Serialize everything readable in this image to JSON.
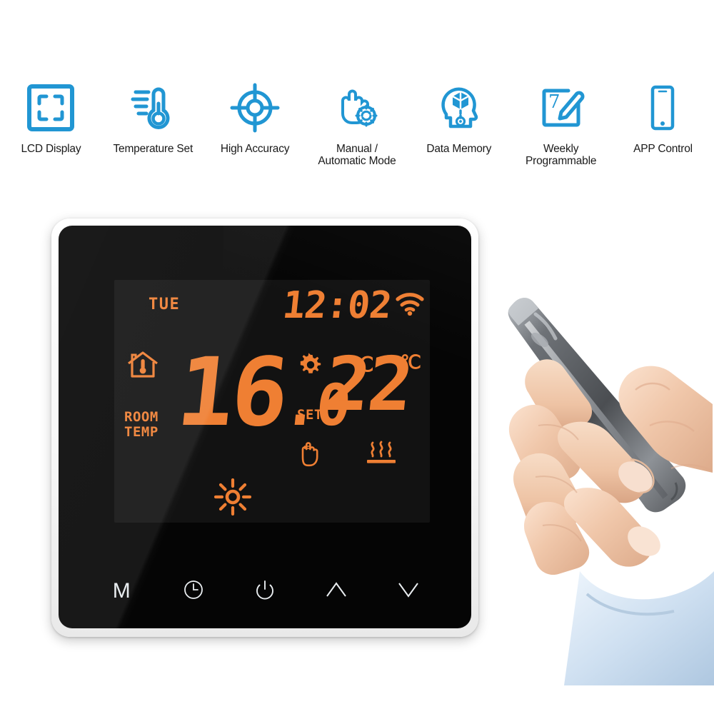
{
  "features": [
    {
      "icon": "lcd-display-icon",
      "label": "LCD Display"
    },
    {
      "icon": "thermometer-icon",
      "label": "Temperature Set"
    },
    {
      "icon": "crosshair-target-icon",
      "label": "High Accuracy"
    },
    {
      "icon": "hand-touch-auto-icon",
      "label": "Manual /\nAutomatic Mode"
    },
    {
      "icon": "head-memory-icon",
      "label": "Data Memory"
    },
    {
      "icon": "calendar-pencil-icon",
      "label": "Weekly\nProgrammable"
    },
    {
      "icon": "smartphone-icon",
      "label": "APP Control"
    }
  ],
  "thermostat": {
    "lcd": {
      "weekday": "TUE",
      "clock": "12:02",
      "wifi_icon": "wifi-icon",
      "room_icon": "house-thermometer-icon",
      "room_label_line1": "ROOM",
      "room_label_line2": "TEMP",
      "room_temperature": "16",
      "room_temperature_decimal": ".0",
      "room_unit": "℃",
      "set_icon": "gear-icon",
      "set_label": "SET",
      "set_temperature": "22",
      "set_unit": "℃",
      "manual_icon": "hand-icon",
      "heating_icon": "floor-heating-icon",
      "brightness_icon": "sun-icon",
      "digit_color": "#ef7f33",
      "background_color": "#121212"
    },
    "buttons": [
      {
        "name": "mode-button",
        "glyph": "M"
      },
      {
        "name": "clock-button",
        "glyph": "clock-icon"
      },
      {
        "name": "power-button",
        "glyph": "power-icon"
      },
      {
        "name": "up-button",
        "glyph": "chevron-up-icon"
      },
      {
        "name": "down-button",
        "glyph": "chevron-down-icon"
      }
    ],
    "bezel_color": "#ffffff",
    "glass_color": "#050505"
  },
  "photo": {
    "description": "hands-holding-smartphone",
    "phone_body_color": "#6f7378",
    "skin_color": "#f0cdb4",
    "sleeve_color": "#cfe1f2"
  },
  "theme": {
    "accent_blue": "#2196d3",
    "lcd_orange": "#ef7f33",
    "text_dark": "#1a1a1a",
    "page_background": "#ffffff"
  }
}
